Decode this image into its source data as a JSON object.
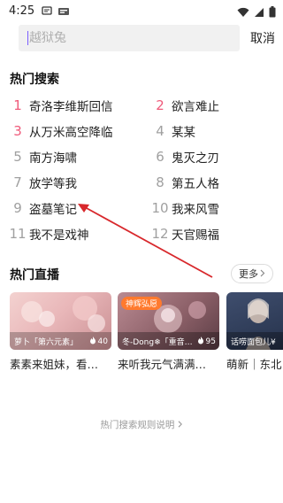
{
  "status_bar": {
    "time": "4:25"
  },
  "search": {
    "placeholder": "越狱兔",
    "cancel_label": "取消"
  },
  "hot_search": {
    "title": "热门搜索",
    "items": [
      {
        "rank": "1",
        "text": "奇洛李维斯回信",
        "top": true
      },
      {
        "rank": "2",
        "text": "欲言难止",
        "top": true
      },
      {
        "rank": "3",
        "text": "从万米高空降临",
        "top": true
      },
      {
        "rank": "4",
        "text": "某某",
        "top": false
      },
      {
        "rank": "5",
        "text": "南方海啸",
        "top": false
      },
      {
        "rank": "6",
        "text": "鬼灭之刃",
        "top": false
      },
      {
        "rank": "7",
        "text": "放学等我",
        "top": false
      },
      {
        "rank": "8",
        "text": "第五人格",
        "top": false
      },
      {
        "rank": "9",
        "text": "盗墓笔记",
        "top": false
      },
      {
        "rank": "10",
        "text": "我来风雪",
        "top": false
      },
      {
        "rank": "11",
        "text": "我不是戏神",
        "top": false
      },
      {
        "rank": "12",
        "text": "天官赐福",
        "top": false
      }
    ]
  },
  "hot_live": {
    "title": "热门直播",
    "more_label": "更多",
    "cards": [
      {
        "streamer": "萝卜「第六元素」",
        "viewers": "40",
        "title": "素素来姐妹，看…",
        "badge": "",
        "thumb_color": "#e9b7b9"
      },
      {
        "streamer": "冬-Dong❄「重音…",
        "viewers": "95",
        "title": "来听我元气满满…",
        "badge": "神辉弘愿",
        "thumb_color": "#8c6068"
      },
      {
        "streamer": "话唠面包儿¥",
        "viewers": "",
        "title": "萌新｜东北",
        "badge": "",
        "thumb_color": "#2d3a55"
      }
    ]
  },
  "footer": {
    "rules_label": "热门搜索规则说明"
  },
  "colors": {
    "accent_rank": "#ef5a7a",
    "annotation_arrow": "#d8282c"
  }
}
